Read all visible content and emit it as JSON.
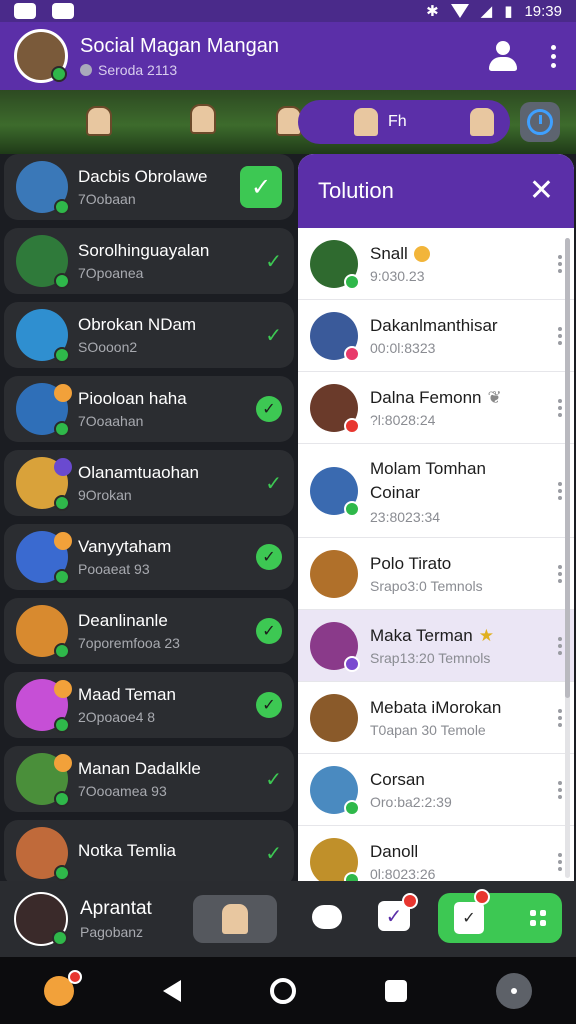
{
  "statusbar": {
    "time": "19:39"
  },
  "header": {
    "title": "Social Magan Mangan",
    "subtitle": "Seroda 2113",
    "avatar_color": "#7a5a3a"
  },
  "scene": {
    "pill_label": "Fh"
  },
  "left_list": {
    "items": [
      {
        "name": "Dacbis Obrolawe",
        "meta": "7Oobaan",
        "status": "check-square",
        "avatar": "#3a78b8"
      },
      {
        "name": "Sorolhinguayalan",
        "meta": "7Opoanea",
        "status": "check",
        "avatar": "#2f7a3a"
      },
      {
        "name": "Obrokan NDam",
        "meta": "SOooon2",
        "status": "check",
        "avatar": "#2f8fd0"
      },
      {
        "name": "Piooloan haha",
        "meta": "7Ooaahan",
        "status": "check-circle",
        "avatar": "#2f6fb8"
      },
      {
        "name": "Olanamtuaohan",
        "meta": "9Orokan",
        "status": "check",
        "avatar": "#d9a23a"
      },
      {
        "name": "Vanyytaham",
        "meta": "Pooaeat 93",
        "status": "check-circle",
        "avatar": "#3a6ad0"
      },
      {
        "name": "Deanlinanle",
        "meta": "7oporemfooa 23",
        "status": "check-circle",
        "avatar": "#d88a2f"
      },
      {
        "name": "Maad Teman",
        "meta": "2Opoaoe4 8",
        "status": "check-circle",
        "avatar": "#c64fd6"
      },
      {
        "name": "Manan Dadalkle",
        "meta": "7Oooamea 93",
        "status": "check",
        "avatar": "#4a8f3a"
      },
      {
        "name": "Notka Temlia",
        "meta": "",
        "status": "check",
        "avatar": "#c06a3a"
      }
    ]
  },
  "panel": {
    "title": "Tolution",
    "close": "✕",
    "items": [
      {
        "name": "Snall",
        "meta": "9:030.23",
        "avatar": "#2f6a2f",
        "emoji": true
      },
      {
        "name": "Dakanlmanthisar",
        "meta": "00:0l:8323",
        "avatar": "#3a5a9a"
      },
      {
        "name": "Dalna Femonn",
        "meta": "?l:8028:24",
        "avatar": "#6a3a2a",
        "extra": "❦"
      },
      {
        "name": "Molam Tomhan Coinar",
        "meta": "23:8023:34",
        "avatar": "#3a6ab0"
      },
      {
        "name": "Polo Tirato",
        "meta": "Srapo3:0 Temnols",
        "avatar": "#b0702a"
      },
      {
        "name": "Maka Terman",
        "meta": "Srap13:20 Temnols",
        "avatar": "#8a3a8a",
        "extra": "★"
      },
      {
        "name": "Mebata iMorokan",
        "meta": "T0apan 30 Temole",
        "avatar": "#8a5a2a"
      },
      {
        "name": "Corsan",
        "meta": "Oro:ba2:2:39",
        "avatar": "#4a8ac0"
      },
      {
        "name": "Danoll",
        "meta": "0l:8023:26",
        "avatar": "#c0902a"
      }
    ]
  },
  "bottom": {
    "name": "Aprantat",
    "meta": "Pagobanz"
  }
}
